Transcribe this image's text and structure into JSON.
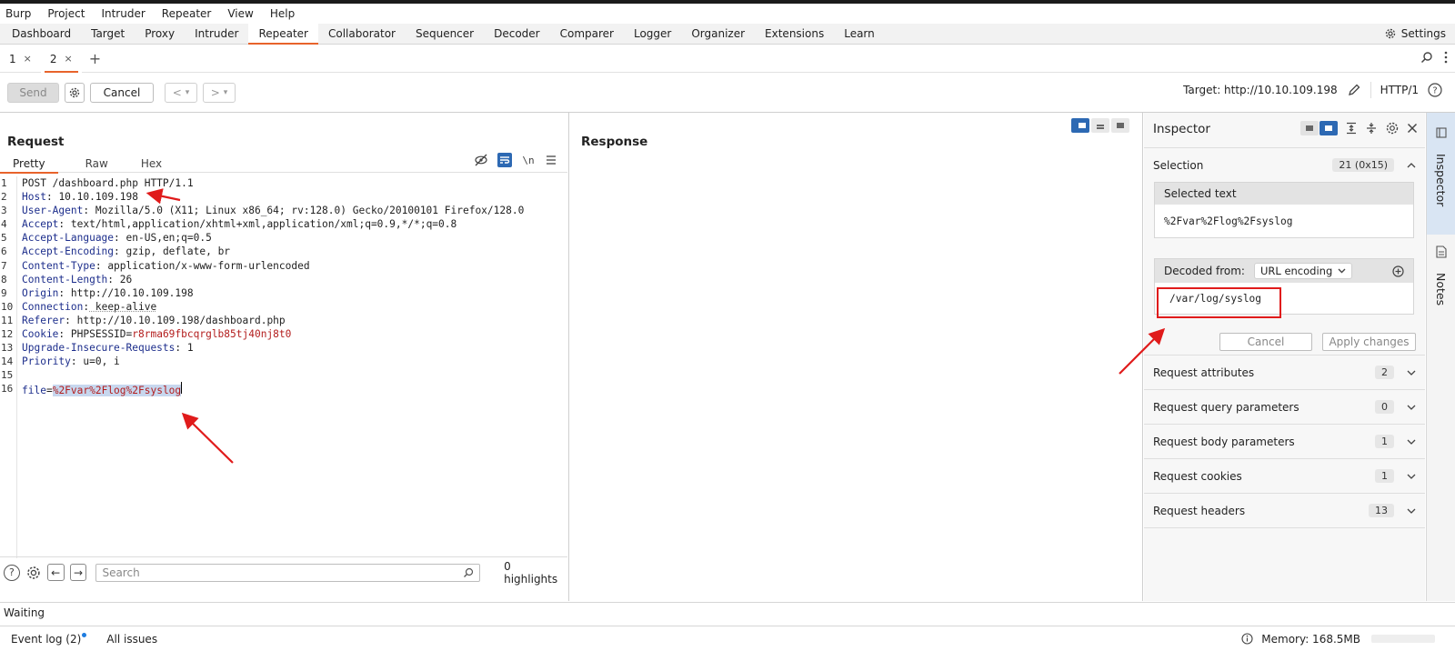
{
  "menubar": [
    "Burp",
    "Project",
    "Intruder",
    "Repeater",
    "View",
    "Help"
  ],
  "main_tabs": [
    {
      "label": "Dashboard"
    },
    {
      "label": "Target"
    },
    {
      "label": "Proxy"
    },
    {
      "label": "Intruder"
    },
    {
      "label": "Repeater",
      "active": true
    },
    {
      "label": "Collaborator"
    },
    {
      "label": "Sequencer"
    },
    {
      "label": "Decoder"
    },
    {
      "label": "Comparer"
    },
    {
      "label": "Logger"
    },
    {
      "label": "Organizer"
    },
    {
      "label": "Extensions"
    },
    {
      "label": "Learn"
    }
  ],
  "settings_label": "Settings",
  "repeater_tabs": [
    {
      "label": "1",
      "close": "×"
    },
    {
      "label": "2",
      "close": "×",
      "active": true
    }
  ],
  "add_tab": "+",
  "toolbar": {
    "send": "Send",
    "cancel": "Cancel",
    "back": "<",
    "forward": ">",
    "dropdown": "▾"
  },
  "target": {
    "label": "Target: http://10.10.109.198",
    "protocol": "HTTP/1"
  },
  "request": {
    "title": "Request",
    "tabs": [
      "Pretty",
      "Raw",
      "Hex"
    ],
    "active_tab": "Pretty",
    "lines": [
      {
        "n": "1",
        "k": "",
        "v": "POST /dashboard.php HTTP/1.1"
      },
      {
        "n": "2",
        "k": "Host",
        "v": " 10.10.109.198"
      },
      {
        "n": "3",
        "k": "User-Agent",
        "v": " Mozilla/5.0 (X11; Linux x86_64; rv:128.0) Gecko/20100101 Firefox/128.0"
      },
      {
        "n": "4",
        "k": "Accept",
        "v": " text/html,application/xhtml+xml,application/xml;q=0.9,*/*;q=0.8"
      },
      {
        "n": "5",
        "k": "Accept-Language",
        "v": " en-US,en;q=0.5"
      },
      {
        "n": "6",
        "k": "Accept-Encoding",
        "v": " gzip, deflate, br"
      },
      {
        "n": "7",
        "k": "Content-Type",
        "v": " application/x-www-form-urlencoded"
      },
      {
        "n": "8",
        "k": "Content-Length",
        "v": " 26"
      },
      {
        "n": "9",
        "k": "Origin",
        "v": " http://10.10.109.198"
      },
      {
        "n": "10",
        "k": "Connection",
        "v": " keep-alive"
      },
      {
        "n": "11",
        "k": "Referer",
        "v": " http://10.10.109.198/dashboard.php"
      },
      {
        "n": "12",
        "k": "Cookie",
        "v": " PHPSESSID=",
        "red": "r8rma69fbcqrglb85tj40nj8t0"
      },
      {
        "n": "13",
        "k": "Upgrade-Insecure-Requests",
        "v": " 1"
      },
      {
        "n": "14",
        "k": "Priority",
        "v": " u=0, i"
      },
      {
        "n": "15",
        "k": "",
        "v": ""
      },
      {
        "n": "16",
        "k": "",
        "v": "",
        "body_key": "file",
        "body_eq": "=",
        "body_val": "%2Fvar%2Flog%2Fsyslog"
      }
    ],
    "search_placeholder": "Search",
    "highlights": "0 highlights"
  },
  "response": {
    "title": "Response"
  },
  "inspector": {
    "title": "Inspector",
    "selection": {
      "label": "Selection",
      "badge": "21 (0x15)"
    },
    "selected_text": {
      "header": "Selected text",
      "value": "%2Fvar%2Flog%2Fsyslog"
    },
    "decoded": {
      "header": "Decoded from:",
      "encoding": "URL encoding",
      "value": "/var/log/syslog"
    },
    "cancel": "Cancel",
    "apply": "Apply changes",
    "sections": [
      {
        "label": "Request attributes",
        "count": "2"
      },
      {
        "label": "Request query parameters",
        "count": "0"
      },
      {
        "label": "Request body parameters",
        "count": "1"
      },
      {
        "label": "Request cookies",
        "count": "1"
      },
      {
        "label": "Request headers",
        "count": "13"
      }
    ]
  },
  "sidebar": {
    "inspector": "Inspector",
    "notes": "Notes"
  },
  "status": "Waiting",
  "bottom": {
    "event_log": "Event log (2)",
    "all_issues": "All issues",
    "memory": "Memory: 168.5MB"
  },
  "colors": {
    "accent": "#e8632b",
    "selection": "#2d69b3",
    "annotation": "#e01b1b",
    "header_key": "#1d2e8c",
    "value_red": "#b31d1d"
  }
}
